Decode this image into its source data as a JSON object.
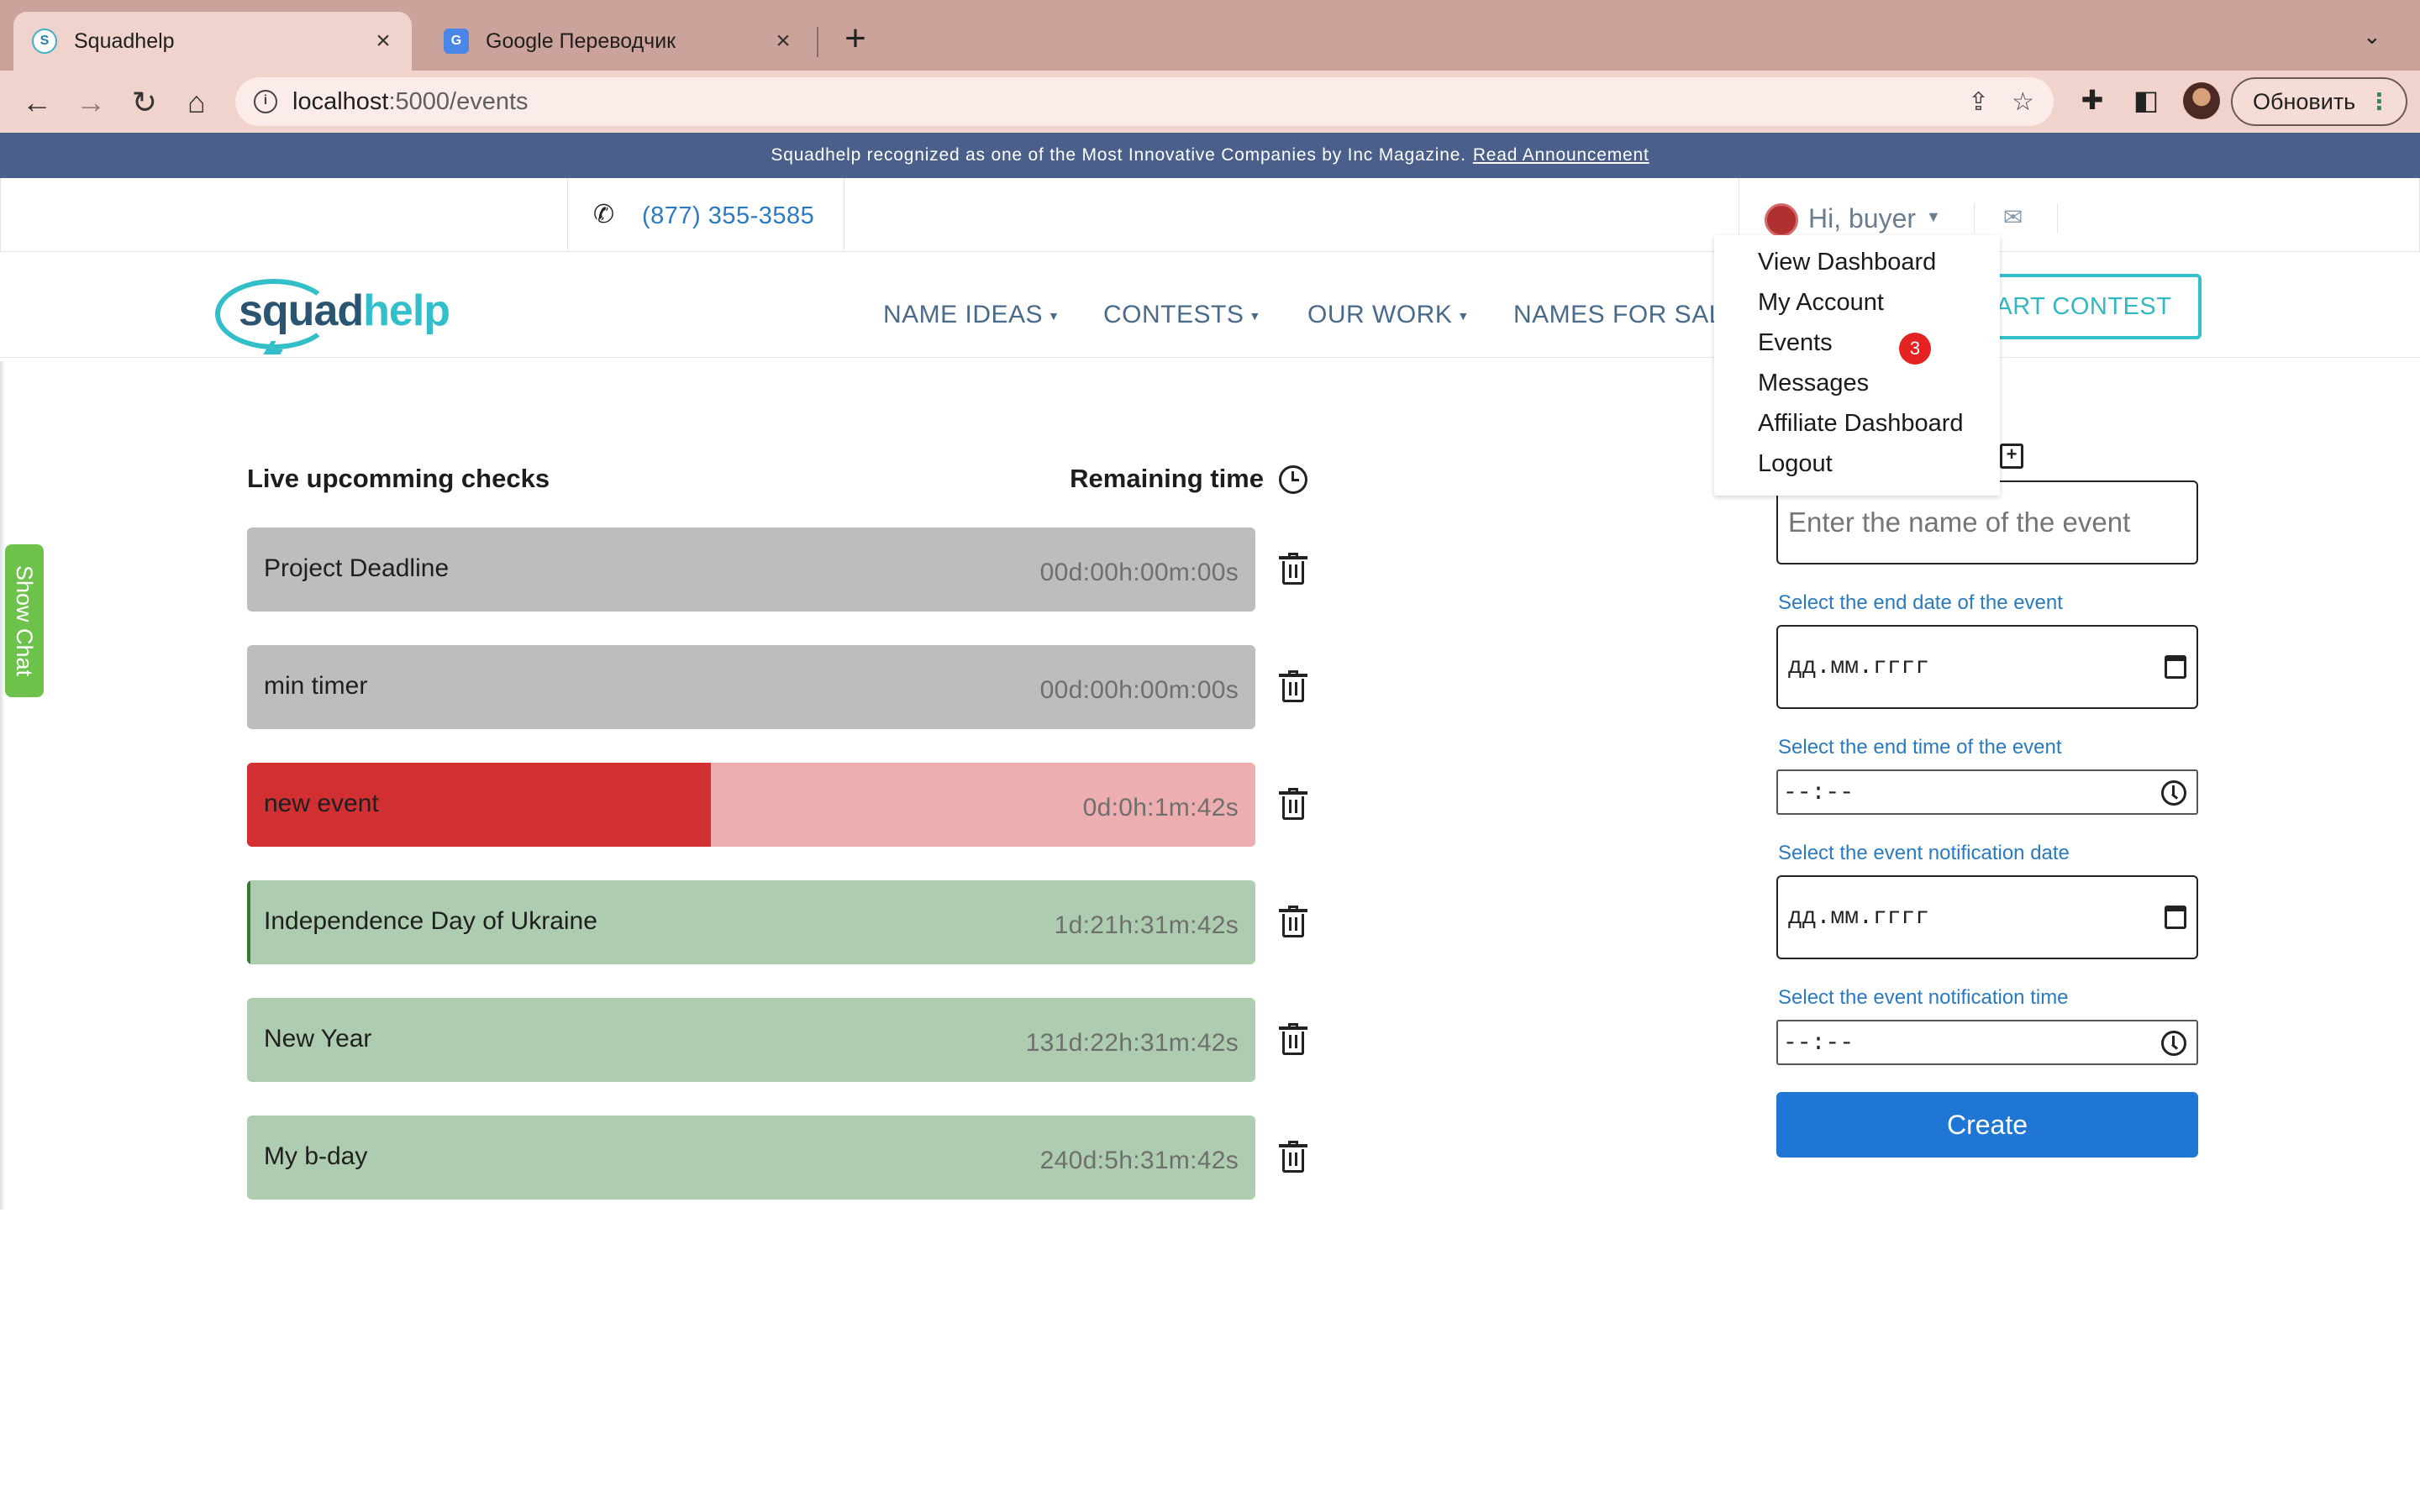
{
  "browser": {
    "tabs": [
      {
        "title": "Squadhelp",
        "favicon": "squadhelp-favicon",
        "active": true
      },
      {
        "title": "Google Переводчик",
        "favicon": "google-translate-favicon",
        "active": false
      }
    ],
    "url_host": "localhost",
    "url_path": ":5000/events",
    "update_label": "Обновить"
  },
  "announcement": {
    "text": "Squadhelp recognized as one of the Most Innovative Companies by Inc Magazine.",
    "link": "Read Announcement"
  },
  "contact": {
    "phone": "(877) 355-3585",
    "greeting": "Hi, buyer"
  },
  "logo": {
    "part1": "squad",
    "part2": "help"
  },
  "nav": {
    "items": [
      "NAME IDEAS",
      "CONTESTS",
      "OUR WORK",
      "NAMES FOR SALE"
    ],
    "cta": "START CONTEST"
  },
  "user_menu": {
    "items": [
      "View Dashboard",
      "My Account",
      "Events",
      "Messages",
      "Affiliate Dashboard",
      "Logout"
    ],
    "events_badge": "3"
  },
  "chat": {
    "label": "Show Chat"
  },
  "events_list": {
    "title": "Live upcomming checks",
    "remaining_label": "Remaining time",
    "events": [
      {
        "name": "Project Deadline",
        "time": "00d:00h:00m:00s",
        "status": "expired",
        "progress": 1.0
      },
      {
        "name": "min timer",
        "time": "00d:00h:00m:00s",
        "status": "expired",
        "progress": 1.0
      },
      {
        "name": "new event",
        "time": "0d:0h:1m:42s",
        "status": "alert",
        "progress": 0.46
      },
      {
        "name": "Independence Day of Ukraine",
        "time": "1d:21h:31m:42s",
        "status": "active",
        "progress": 0.003
      },
      {
        "name": "New Year",
        "time": "131d:22h:31m:42s",
        "status": "active",
        "progress": 0.0
      },
      {
        "name": "My b-day",
        "time": "240d:5h:31m:42s",
        "status": "active",
        "progress": 0.0
      }
    ],
    "colors": {
      "expired": "#bcbdbf",
      "alert_fill": "#d22f33",
      "alert_bg": "#ecaeae",
      "active": "#aecdb0",
      "active_fill": "#2e7d32"
    }
  },
  "form": {
    "name_placeholder": "Enter the name of the event",
    "end_date_label": "Select the end date of the event",
    "end_date_value": "дд.мм.гггг",
    "end_time_label": "Select the end time of the event",
    "end_time_value": "--:--",
    "notify_date_label": "Select the event notification date",
    "notify_date_value": "дд.мм.гггг",
    "notify_time_label": "Select the event notification time",
    "notify_time_value": "--:--",
    "submit_label": "Create"
  }
}
